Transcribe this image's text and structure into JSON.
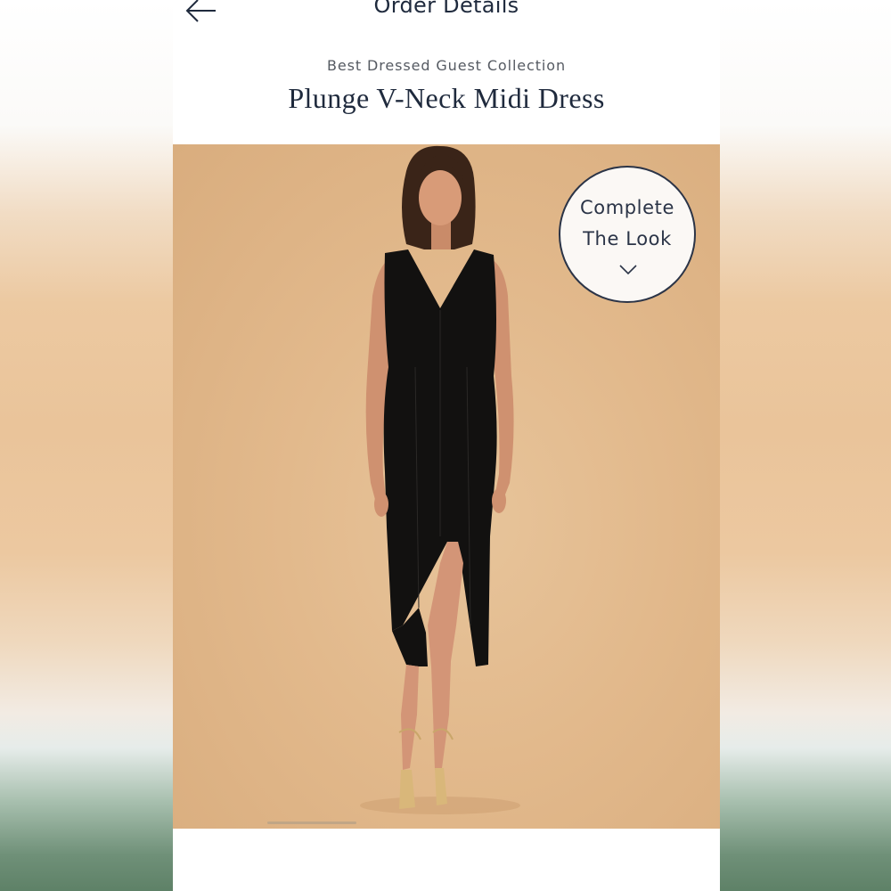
{
  "header": {
    "title": "Order Details",
    "back_icon": "arrow-left-icon"
  },
  "product": {
    "collection": "Best Dressed Guest Collection",
    "name": "Plunge V-Neck Midi Dress",
    "image_description_icon": "product-photo"
  },
  "complete_the_look": {
    "line1": "Complete",
    "line2": "The Look",
    "icon": "chevron-down-icon"
  },
  "colors": {
    "nav_text": "#1f2a3d",
    "badge_border": "#2b3447",
    "hero_background": "#e2b98c"
  }
}
